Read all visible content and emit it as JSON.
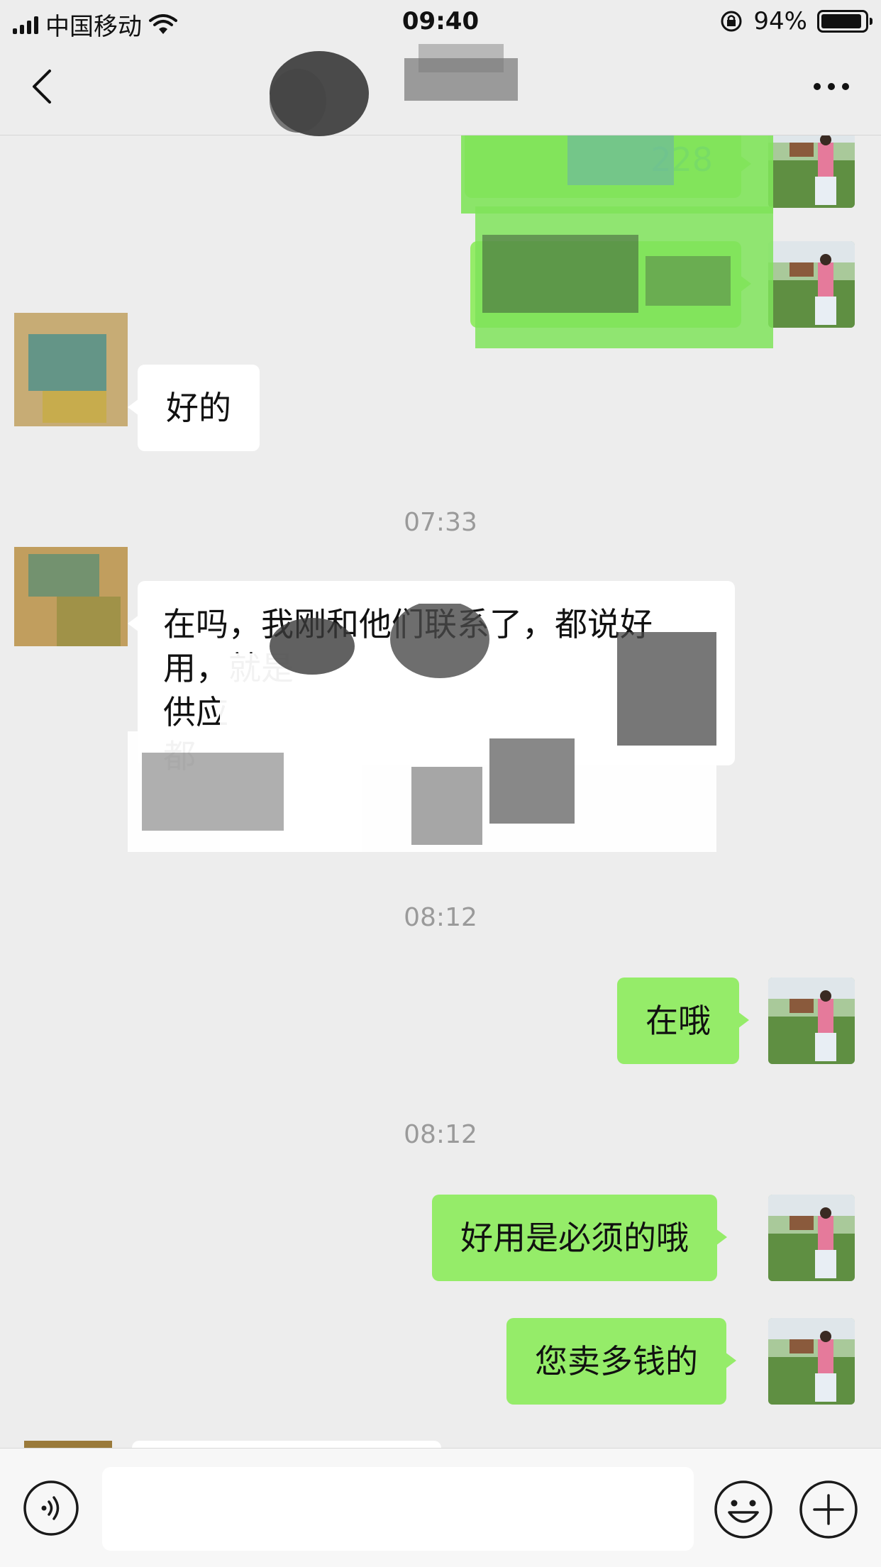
{
  "status_bar": {
    "carrier": "中国移动",
    "time": "09:40",
    "battery_percent": "94%",
    "battery_level": 0.94
  },
  "nav": {
    "title": "",
    "back_icon": "chevron-left-icon",
    "more_icon": "more-dots-icon"
  },
  "messages": [
    {
      "id": "m1",
      "side": "right",
      "text": "228",
      "obscured": true
    },
    {
      "id": "m2",
      "side": "right",
      "text": "",
      "obscured": true
    },
    {
      "id": "m3",
      "side": "left",
      "text": "好的"
    },
    {
      "id": "t1",
      "type": "timestamp",
      "text": "07:33"
    },
    {
      "id": "m4",
      "side": "left",
      "lines": [
        "在吗，我刚和他们联系了，都说好",
        "用，就是",
        "供应",
        "都"
      ],
      "obscured": true
    },
    {
      "id": "t2",
      "type": "timestamp",
      "text": "08:12"
    },
    {
      "id": "m5",
      "side": "right",
      "text": "在哦"
    },
    {
      "id": "t3",
      "type": "timestamp",
      "text": "08:12"
    },
    {
      "id": "m6",
      "side": "right",
      "text": "好用是必须的哦"
    },
    {
      "id": "m7",
      "side": "right",
      "text": "您卖多钱的"
    }
  ],
  "input_bar": {
    "value": "",
    "voice_icon": "voice-icon",
    "emoji_icon": "emoji-icon",
    "plus_icon": "plus-icon"
  },
  "colors": {
    "background": "#ededed",
    "bubble_self": "#95ec69",
    "bubble_other": "#ffffff",
    "timestamp": "#9a9a9a"
  }
}
